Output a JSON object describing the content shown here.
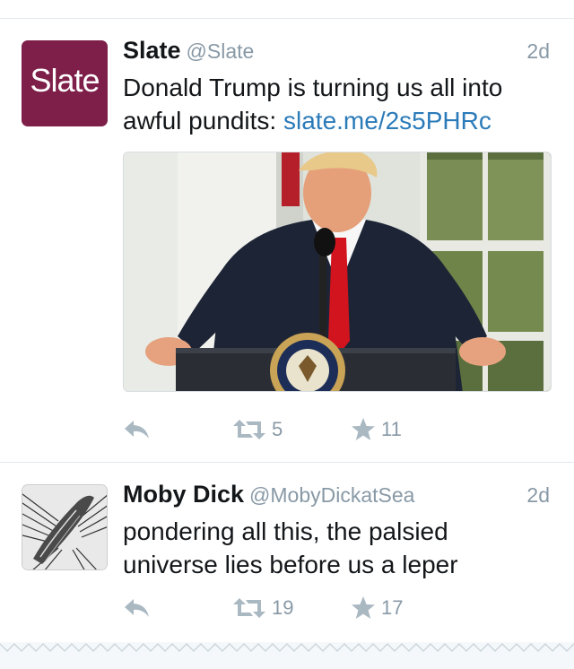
{
  "tweets": [
    {
      "name": "Slate",
      "handle": "@Slate",
      "time": "2d",
      "avatar_text": "Slate",
      "text": "Donald Trump is turning us all into awful pundits: ",
      "link": "slate.me/2s5PHRc",
      "reply_icon": "reply-icon",
      "retweet_icon": "retweet-icon",
      "like_icon": "star-icon",
      "retweets": "5",
      "likes": "11"
    },
    {
      "name": "Moby Dick",
      "handle": "@MobyDickatSea",
      "time": "2d",
      "text": "pondering all this, the palsied universe lies before us a leper",
      "reply_icon": "reply-icon",
      "retweet_icon": "retweet-icon",
      "like_icon": "star-icon",
      "retweets": "19",
      "likes": "17"
    }
  ],
  "colors": {
    "slate_brand": "#7e1f4a",
    "link": "#2b7bb9",
    "meta_gray": "#8899a6",
    "icon_gray": "#aab8c2"
  }
}
